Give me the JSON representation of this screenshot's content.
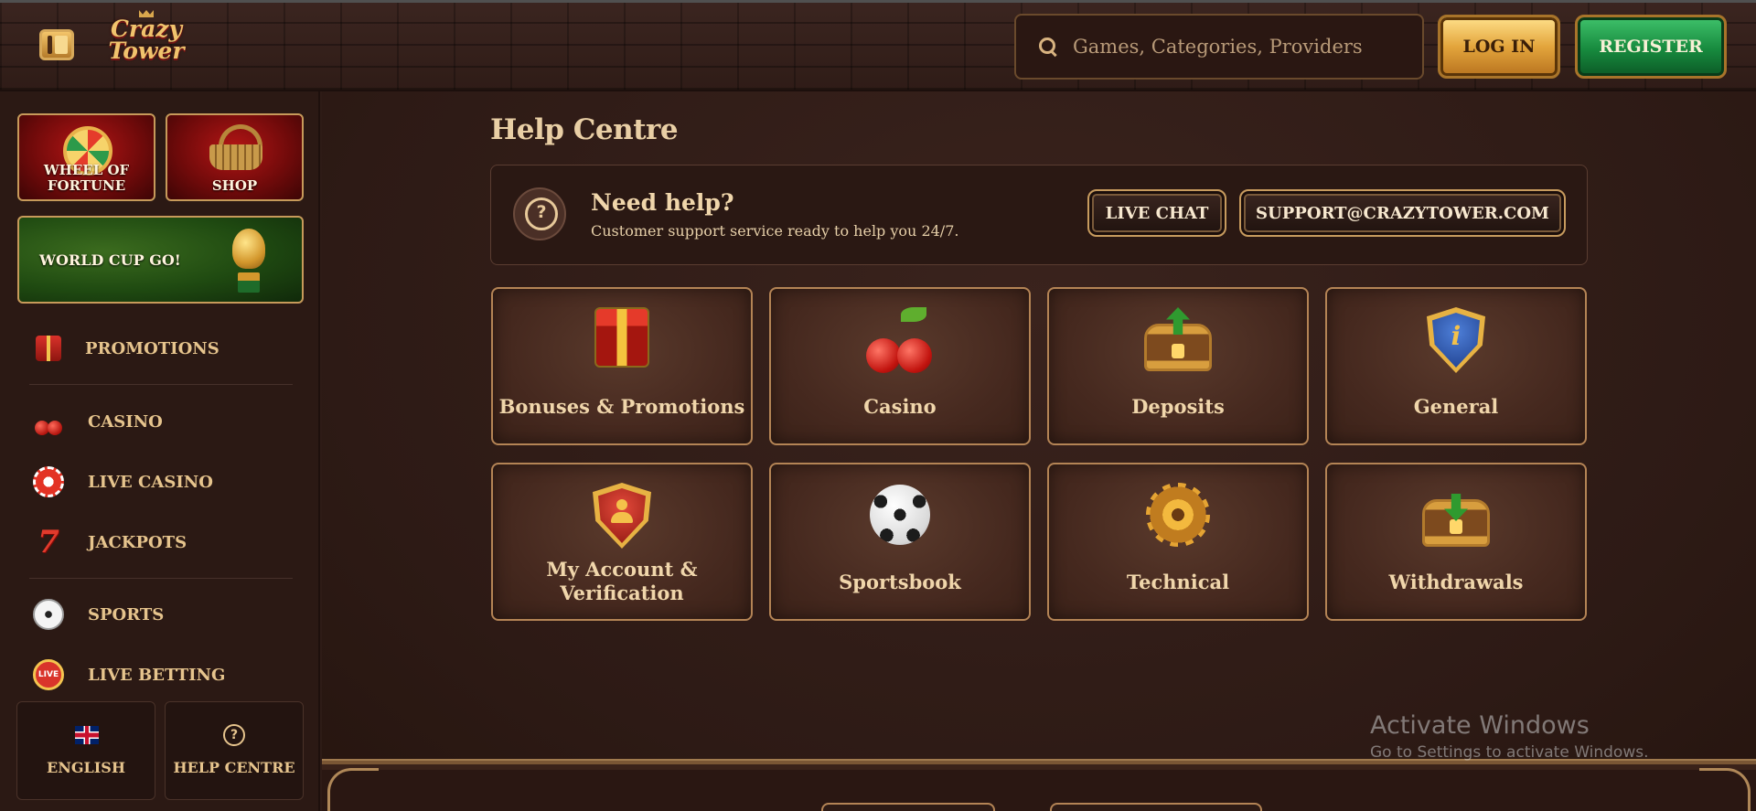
{
  "header": {
    "logo_line1": "Crazy",
    "logo_line2": "Tower",
    "search_placeholder": "Games, Categories, Providers",
    "login_label": "LOG IN",
    "register_label": "REGISTER"
  },
  "sidebar": {
    "tiles": {
      "wheel": "WHEEL OF FORTUNE",
      "shop": "SHOP",
      "world_cup": "WORLD CUP GO!"
    },
    "nav": [
      {
        "label": "PROMOTIONS",
        "icon": "gift-icon"
      },
      {
        "label": "CASINO",
        "icon": "cherry-icon"
      },
      {
        "label": "LIVE CASINO",
        "icon": "casino-chip-icon"
      },
      {
        "label": "JACKPOTS",
        "icon": "seven-icon"
      },
      {
        "label": "SPORTS",
        "icon": "soccer-ball-icon"
      },
      {
        "label": "LIVE BETTING",
        "icon": "live-badge-icon"
      }
    ],
    "live_icon_text": "LIVE",
    "language_label": "ENGLISH",
    "help_label": "HELP CENTRE"
  },
  "main": {
    "title": "Help Centre",
    "help_banner": {
      "title": "Need help?",
      "subtitle": "Customer support service ready to help you 24/7.",
      "chat_label": "LIVE CHAT",
      "email_label": "SUPPORT@CRAZYTOWER.COM"
    },
    "categories": [
      {
        "label": "Bonuses & Promotions",
        "icon": "gift-icon"
      },
      {
        "label": "Casino",
        "icon": "cherry-icon"
      },
      {
        "label": "Deposits",
        "icon": "chest-deposit-icon"
      },
      {
        "label": "General",
        "icon": "info-shield-icon"
      },
      {
        "label": "My Account & Verification",
        "icon": "account-shield-icon"
      },
      {
        "label": "Sportsbook",
        "icon": "soccer-ball-icon"
      },
      {
        "label": "Technical",
        "icon": "gear-icon"
      },
      {
        "label": "Withdrawals",
        "icon": "chest-withdraw-icon"
      }
    ]
  },
  "watermark": {
    "line1": "Activate Windows",
    "line2": "Go to Settings to activate Windows."
  },
  "colors": {
    "background": "#2e1b16",
    "gold_text": "#e6c48d",
    "card_border": "#b48455",
    "login_gold": "#e3a53c",
    "register_green": "#178a3e"
  }
}
